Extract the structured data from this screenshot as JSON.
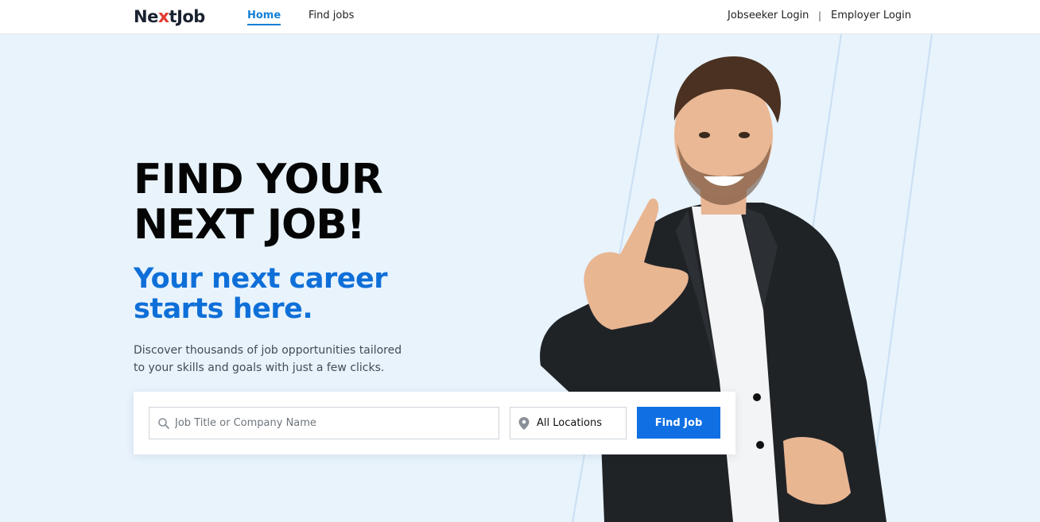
{
  "header": {
    "logo_prefix": "Ne",
    "logo_x": "x",
    "logo_suffix": "tJob",
    "nav": {
      "home": "Home",
      "find_jobs": "Find jobs"
    },
    "login": {
      "jobseeker": "Jobseeker Login",
      "separator": "|",
      "employer": "Employer Login"
    }
  },
  "hero": {
    "title_line1": "FIND YOUR",
    "title_line2": "NEXT JOB!",
    "subtitle_line1": "Your next career",
    "subtitle_line2": "starts here.",
    "desc_line1": "Discover thousands of job opportunities tailored",
    "desc_line2": "to your skills and goals with just a few clicks."
  },
  "search": {
    "placeholder": "Job Title or Company Name",
    "value": "",
    "location": "All Locations",
    "button": "Find Job"
  },
  "colors": {
    "accent": "#0f6fe3",
    "subtitle": "#0f6fd8",
    "background": "#e8f3fc",
    "logo_x": "#e23b32"
  },
  "icons": [
    "search-icon",
    "location-pin-icon"
  ]
}
